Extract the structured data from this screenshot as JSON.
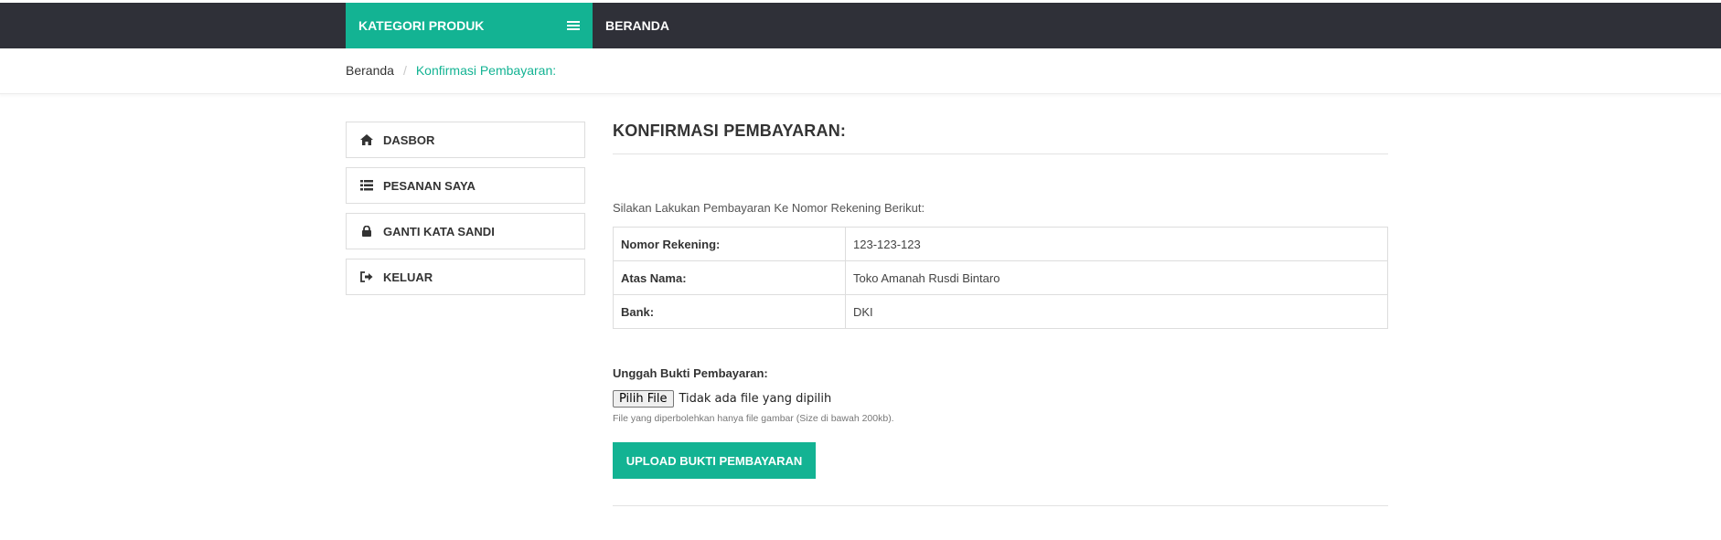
{
  "header": {
    "category_label": "KATEGORI PRODUK",
    "nav_home": "BERANDA"
  },
  "breadcrumb": {
    "home": "Beranda",
    "separator": "/",
    "current": "Konfirmasi Pembayaran:"
  },
  "sidebar": {
    "items": [
      {
        "label": "DASBOR",
        "icon": "home-icon"
      },
      {
        "label": "PESANAN SAYA",
        "icon": "list-icon"
      },
      {
        "label": "GANTI KATA SANDI",
        "icon": "lock-icon"
      },
      {
        "label": "KELUAR",
        "icon": "sign-out-icon"
      }
    ]
  },
  "main": {
    "title": "KONFIRMASI PEMBAYARAN:",
    "intro": "Silakan Lakukan Pembayaran Ke Nomor Rekening Berikut:",
    "account_rows": [
      {
        "key": "Nomor Rekening:",
        "value": "123-123-123"
      },
      {
        "key": "Atas Nama:",
        "value": "Toko Amanah Rusdi Bintaro"
      },
      {
        "key": "Bank:",
        "value": "DKI"
      }
    ],
    "upload_label": "Unggah Bukti Pembayaran:",
    "file_button": "Pilih File",
    "file_status": "Tidak ada file yang dipilih",
    "hint": "File yang diperbolehkan hanya file gambar (Size di bawah 200kb).",
    "upload_button": "UPLOAD BUKTI PEMBAYARAN"
  },
  "colors": {
    "accent": "#13b393",
    "topbar": "#2f3038"
  }
}
